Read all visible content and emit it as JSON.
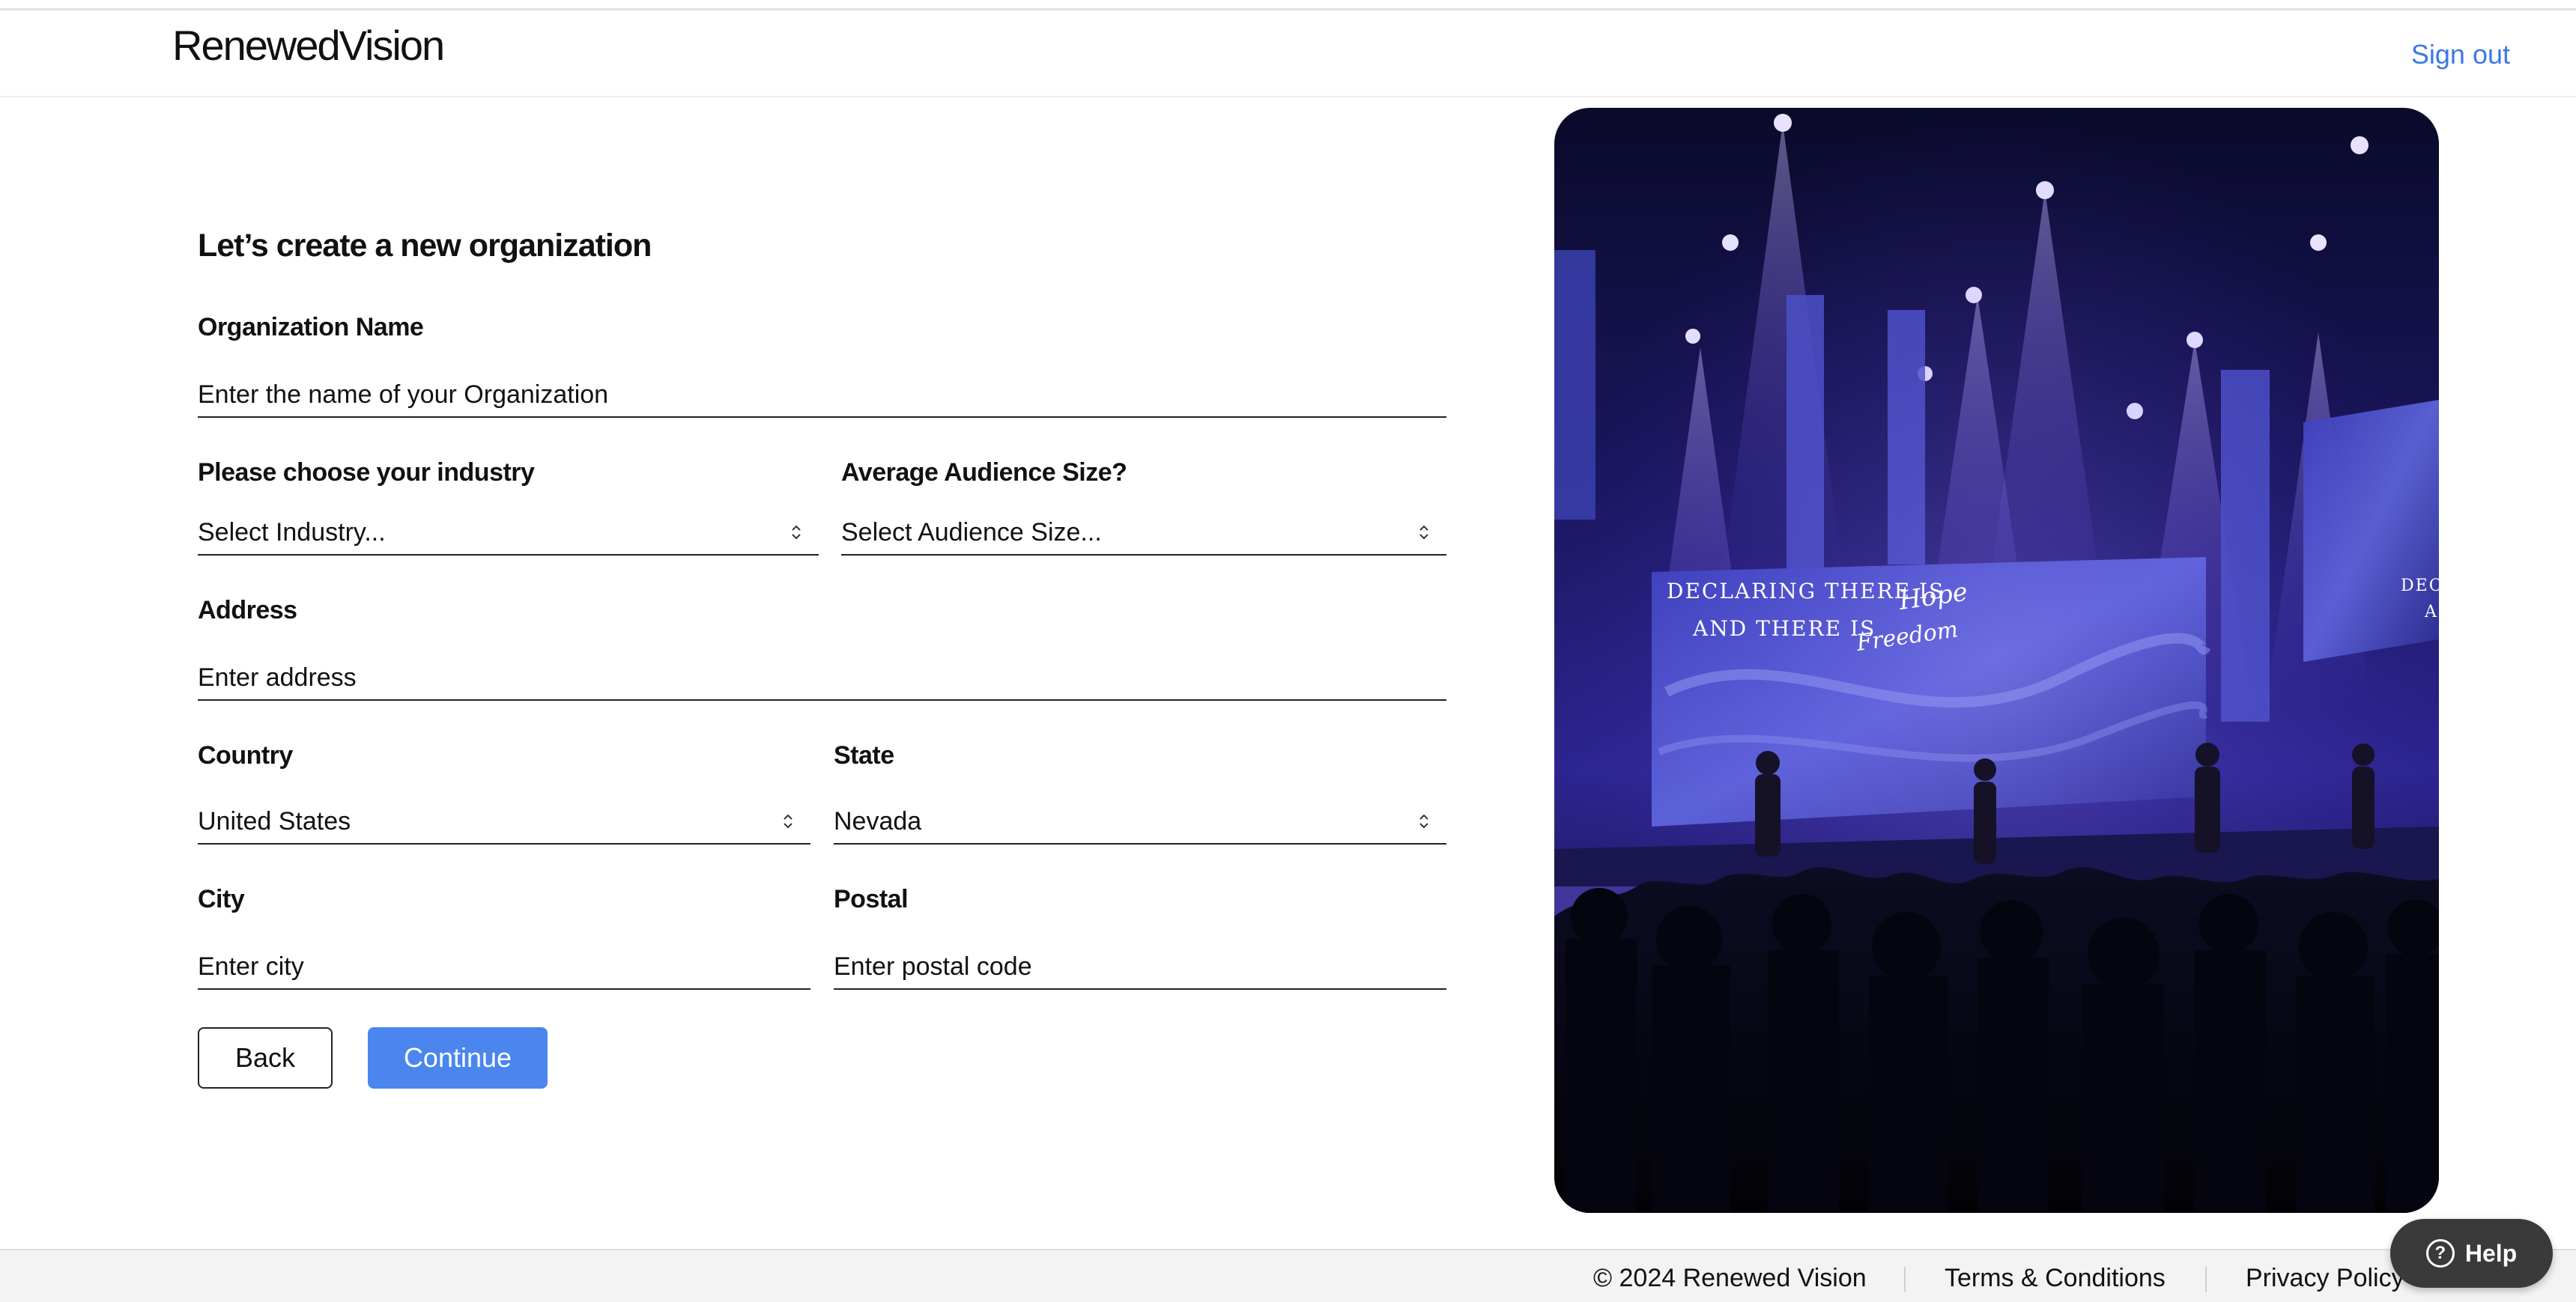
{
  "header": {
    "logo": "RenewedVision",
    "sign_out": "Sign out"
  },
  "form": {
    "title": "Let’s create a new organization",
    "org_name": {
      "label": "Organization Name",
      "placeholder": "Enter the name of your Organization"
    },
    "industry": {
      "label": "Please choose your industry",
      "value": "Select Industry..."
    },
    "audience": {
      "label": "Average Audience Size?",
      "value": "Select Audience Size..."
    },
    "address": {
      "label": "Address",
      "placeholder": "Enter address"
    },
    "country": {
      "label": "Country",
      "value": "United States"
    },
    "state": {
      "label": "State",
      "value": "Nevada"
    },
    "city": {
      "label": "City",
      "placeholder": "Enter city"
    },
    "postal": {
      "label": "Postal",
      "placeholder": "Enter postal code"
    },
    "back_label": "Back",
    "continue_label": "Continue"
  },
  "photo": {
    "screen_line1": "DECLARING THERE IS",
    "screen_word1": "Hope",
    "screen_line2": "AND THERE IS",
    "screen_word2": "Freedom",
    "side_line1": "DEC",
    "side_line2": "A"
  },
  "footer": {
    "copyright": "© 2024 Renewed Vision",
    "terms": "Terms & Conditions",
    "privacy": "Privacy Policy"
  },
  "help": {
    "label": "Help"
  },
  "colors": {
    "accent": "#4a86ee",
    "link": "#3b78e7",
    "help_bg": "#3a3a3a"
  }
}
